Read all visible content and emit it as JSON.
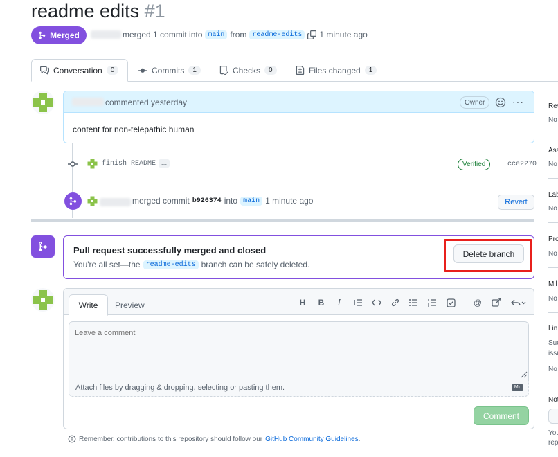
{
  "pr": {
    "title": "readme edits",
    "number": "#1",
    "status": "Merged",
    "meta_merged": "merged 1 commit into",
    "base_branch": "main",
    "from_text": "from",
    "head_branch": "readme-edits",
    "time_ago": "1 minute ago"
  },
  "tabs": [
    {
      "label": "Conversation",
      "count": "0",
      "icon": "comment-icon"
    },
    {
      "label": "Commits",
      "count": "1",
      "icon": "commit-icon"
    },
    {
      "label": "Checks",
      "count": "0",
      "icon": "checklist-icon"
    },
    {
      "label": "Files changed",
      "count": "1",
      "icon": "file-diff-icon"
    }
  ],
  "comment": {
    "header_text": "commented yesterday",
    "badge": "Owner",
    "body": "content for non-telepathic human"
  },
  "commit": {
    "message": "finish README",
    "ellipsis": "…",
    "verified": "Verified",
    "sha": "cce2270"
  },
  "merge_event": {
    "text": "merged commit",
    "sha": "b926374",
    "into": "into",
    "branch": "main",
    "time": "1 minute ago",
    "revert": "Revert"
  },
  "merged_box": {
    "title": "Pull request successfully merged and closed",
    "desc_prefix": "You're all set—the",
    "branch": "readme-edits",
    "desc_suffix": "branch can be safely deleted.",
    "delete_button": "Delete branch"
  },
  "editor": {
    "write_tab": "Write",
    "preview_tab": "Preview",
    "placeholder": "Leave a comment",
    "attach_text": "Attach files by dragging & dropping, selecting or pasting them.",
    "comment_button": "Comment",
    "markdown_badge": "M↓",
    "footer_prefix": "Remember, contributions to this repository should follow our",
    "footer_link": "GitHub Community Guidelines",
    "footer_suffix": "."
  },
  "sidebar": [
    {
      "label": "Rev",
      "value": "No"
    },
    {
      "label": "Ass",
      "value": "No"
    },
    {
      "label": "Lab",
      "value": "No"
    },
    {
      "label": "Pro",
      "value": "No"
    },
    {
      "label": "Mil",
      "value": "No"
    },
    {
      "label": "Linl",
      "value": "Suc",
      "value2": "issu",
      "value3": "No"
    },
    {
      "label": "Not",
      "value": "You",
      "value2": "rep"
    }
  ],
  "colors": {
    "merged_purple": "#8250df",
    "accent_blue": "#0969da",
    "success_green": "#1a7f37",
    "highlight_red": "#e8201c"
  }
}
